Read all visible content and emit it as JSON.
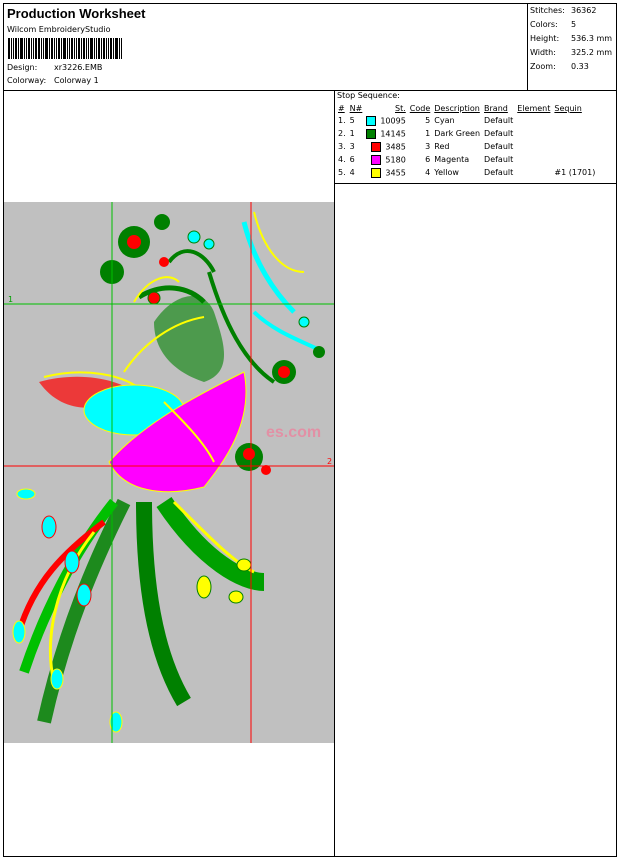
{
  "header": {
    "title": "Production Worksheet",
    "software": "Wilcom EmbroideryStudio",
    "design_label": "Design:",
    "design_value": "xr3226.EMB",
    "colorway_label": "Colorway:",
    "colorway_value": "Colorway 1"
  },
  "stats": [
    {
      "label": "Stitches:",
      "value": "36362"
    },
    {
      "label": "Colors:",
      "value": "5"
    },
    {
      "label": "Height:",
      "value": "536.3 mm"
    },
    {
      "label": "Width:",
      "value": "325.2 mm"
    },
    {
      "label": "Zoom:",
      "value": "0.33"
    }
  ],
  "stop_sequence": {
    "title": "Stop Sequence:",
    "columns": [
      "#",
      "N#",
      "St.",
      "Code",
      "Description",
      "Brand",
      "Element",
      "Sequin"
    ],
    "rows": [
      {
        "num": "1.",
        "n": "5",
        "st": "10095",
        "code": "5",
        "description": "Cyan",
        "brand": "Default",
        "element": "",
        "sequin": "",
        "color": "#00ffff"
      },
      {
        "num": "2.",
        "n": "1",
        "st": "14145",
        "code": "1",
        "description": "Dark Green",
        "brand": "Default",
        "element": "",
        "sequin": "",
        "color": "#008000"
      },
      {
        "num": "3.",
        "n": "3",
        "st": "3485",
        "code": "3",
        "description": "Red",
        "brand": "Default",
        "element": "",
        "sequin": "",
        "color": "#ff0000"
      },
      {
        "num": "4.",
        "n": "6",
        "st": "5180",
        "code": "6",
        "description": "Magenta",
        "brand": "Default",
        "element": "",
        "sequin": "",
        "color": "#ff00ff"
      },
      {
        "num": "5.",
        "n": "4",
        "st": "3455",
        "code": "4",
        "description": "Yellow",
        "brand": "Default",
        "element": "",
        "sequin": "#1 (1701)",
        "color": "#ffff00"
      }
    ]
  },
  "preview": {
    "guide_labels": [
      "1",
      "2"
    ],
    "watermark": "es.com",
    "background": "#c0c0c0",
    "guide_color_vertical": "#00c000",
    "guide_color_red": "#ff0000"
  }
}
